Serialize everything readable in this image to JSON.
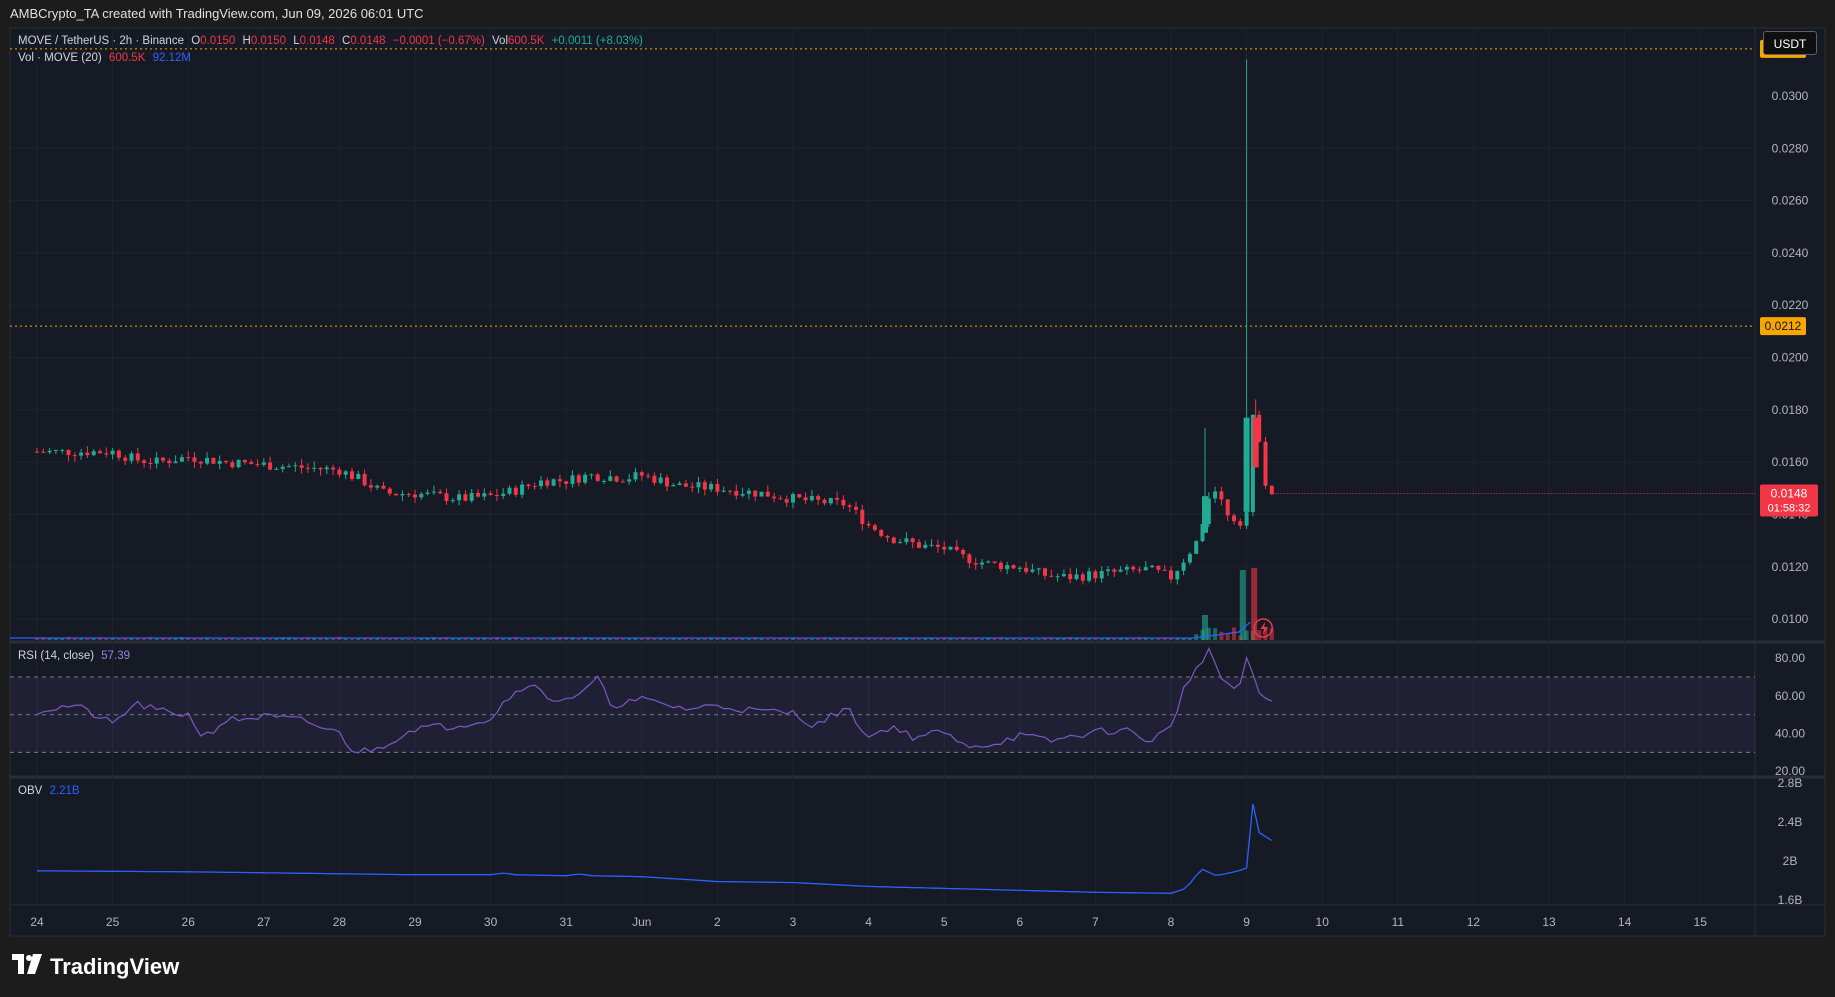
{
  "header": {
    "attribution": "AMBCrypto_TA created with TradingView.com, Jun 09, 2026 06:01 UTC"
  },
  "legend": {
    "symbol": "MOVE / TetherUS · 2h · Binance",
    "o_label": "O",
    "o_value": "0.0150",
    "h_label": "H",
    "h_value": "0.0150",
    "l_label": "L",
    "l_value": "0.0148",
    "c_label": "C",
    "c_value": "0.0148",
    "change": "−0.0001 (−0.67%)",
    "vol_label": "Vol",
    "vol_value": "600.5K",
    "vol_change": "+0.0011 (+8.03%)",
    "vol_study": "Vol · MOVE (20)",
    "vol_study_value": "600.5K",
    "vol_ma_value": "92.12M",
    "rsi_study": "RSI (14, close)",
    "rsi_value": "57.39",
    "obv_study": "OBV",
    "obv_value": "2.21B"
  },
  "currency_button": "USDT",
  "footer": {
    "brand": "TradingView"
  },
  "colors": {
    "up": "#22ab94",
    "down": "#f23645",
    "level": "#f7a600",
    "rsi_line": "#7e57c2",
    "obv_line": "#2962ff",
    "bg": "#161a25"
  },
  "chart_data": {
    "type": "candlestick",
    "price_axis": {
      "ticks": [
        0.01,
        0.012,
        0.014,
        0.016,
        0.018,
        0.02,
        0.022,
        0.024,
        0.026,
        0.028,
        0.03
      ],
      "tick_labels": [
        "0.0100",
        "0.0120",
        "0.0140",
        "0.0160",
        "0.0180",
        "0.0200",
        "0.0220",
        "0.0240",
        "0.0260",
        "0.0280",
        "0.0300"
      ],
      "range": [
        0.0092,
        0.0326
      ]
    },
    "levels": [
      {
        "value": 0.0318,
        "label": "0.0318"
      },
      {
        "value": 0.0212,
        "label": "0.0212"
      }
    ],
    "last_price": {
      "value": 0.0148,
      "label": "0.0148",
      "countdown": "01:58:32"
    },
    "x_axis": {
      "labels": [
        "24",
        "25",
        "26",
        "27",
        "28",
        "29",
        "30",
        "31",
        "Jun",
        "2",
        "3",
        "4",
        "5",
        "6",
        "7",
        "8",
        "9",
        "10",
        "11",
        "12",
        "13",
        "14",
        "15"
      ]
    },
    "price_series": {
      "anchors": [
        [
          0,
          0.0164
        ],
        [
          1,
          0.0164
        ],
        [
          1.3,
          0.0161
        ],
        [
          1.6,
          0.016
        ],
        [
          2,
          0.0162
        ],
        [
          2.5,
          0.016
        ],
        [
          3,
          0.0159
        ],
        [
          3.5,
          0.0158
        ],
        [
          4,
          0.0157
        ],
        [
          4.3,
          0.0153
        ],
        [
          4.6,
          0.0148
        ],
        [
          5,
          0.0148
        ],
        [
          5.3,
          0.0147
        ],
        [
          5.6,
          0.0146
        ],
        [
          6,
          0.0147
        ],
        [
          6.3,
          0.0149
        ],
        [
          6.7,
          0.0153
        ],
        [
          7,
          0.0153
        ],
        [
          7.3,
          0.0155
        ],
        [
          7.8,
          0.0154
        ],
        [
          8,
          0.0155
        ],
        [
          8.5,
          0.0151
        ],
        [
          9,
          0.015
        ],
        [
          9.6,
          0.0148
        ],
        [
          10,
          0.0146
        ],
        [
          10.3,
          0.0145
        ],
        [
          10.7,
          0.0144
        ],
        [
          11,
          0.0136
        ],
        [
          11.3,
          0.0131
        ],
        [
          11.7,
          0.0128
        ],
        [
          12,
          0.0127
        ],
        [
          12.2,
          0.0124
        ],
        [
          12.6,
          0.0121
        ],
        [
          13,
          0.012
        ],
        [
          13.3,
          0.0117
        ],
        [
          13.6,
          0.0116
        ],
        [
          14,
          0.0117
        ],
        [
          14.3,
          0.0118
        ],
        [
          14.7,
          0.0119
        ],
        [
          15,
          0.0116
        ],
        [
          15.2,
          0.0124
        ],
        [
          15.4,
          0.0132
        ],
        [
          15.5,
          0.0147
        ],
        [
          15.6,
          0.0151
        ],
        [
          15.7,
          0.0142
        ],
        [
          15.9,
          0.0137
        ],
        [
          16.0,
          0.0141
        ],
        [
          16.05,
          0.0176
        ],
        [
          16.15,
          0.0177
        ],
        [
          16.2,
          0.0155
        ],
        [
          16.3,
          0.015
        ],
        [
          16.33,
          0.0148
        ]
      ],
      "spikes": [
        {
          "x": 16.0,
          "high": 0.0314,
          "open": 0.0141,
          "close": 0.0177
        },
        {
          "x": 15.45,
          "high": 0.0173,
          "open": 0.0133,
          "close": 0.0147
        },
        {
          "x": 16.12,
          "high": 0.0184,
          "open": 0.0177,
          "close": 0.0158
        }
      ]
    },
    "rsi": {
      "ticks": [
        20,
        40,
        60,
        80
      ],
      "tick_labels": [
        "20.00",
        "40.00",
        "60.00",
        "80.00"
      ],
      "range": [
        18,
        87
      ],
      "band": [
        30,
        70
      ],
      "anchors": [
        [
          0,
          52
        ],
        [
          0.5,
          55
        ],
        [
          1,
          45
        ],
        [
          1.3,
          56
        ],
        [
          1.6,
          52
        ],
        [
          2,
          50
        ],
        [
          2.2,
          38
        ],
        [
          2.5,
          47
        ],
        [
          3,
          49
        ],
        [
          3.5,
          47
        ],
        [
          4,
          40
        ],
        [
          4.2,
          30
        ],
        [
          4.5,
          32
        ],
        [
          5,
          43
        ],
        [
          5.5,
          44
        ],
        [
          6,
          48
        ],
        [
          6.2,
          58
        ],
        [
          6.5,
          67
        ],
        [
          6.8,
          58
        ],
        [
          7.2,
          60
        ],
        [
          7.4,
          70
        ],
        [
          7.6,
          55
        ],
        [
          8,
          58
        ],
        [
          8.6,
          53
        ],
        [
          9,
          55
        ],
        [
          9.5,
          52
        ],
        [
          10,
          51
        ],
        [
          10.3,
          44
        ],
        [
          10.7,
          54
        ],
        [
          11,
          38
        ],
        [
          11.3,
          44
        ],
        [
          11.6,
          38
        ],
        [
          12,
          41
        ],
        [
          12.2,
          34
        ],
        [
          12.6,
          34
        ],
        [
          13,
          39
        ],
        [
          13.4,
          36
        ],
        [
          14,
          41
        ],
        [
          14.4,
          42
        ],
        [
          14.7,
          36
        ],
        [
          15,
          43
        ],
        [
          15.2,
          68
        ],
        [
          15.4,
          76
        ],
        [
          15.5,
          86
        ],
        [
          15.7,
          65
        ],
        [
          15.9,
          64
        ],
        [
          16.0,
          80
        ],
        [
          16.15,
          62
        ],
        [
          16.33,
          57
        ]
      ]
    },
    "obv": {
      "ticks": [
        1.6,
        2.0,
        2.4,
        2.8
      ],
      "tick_labels": [
        "1.6B",
        "2B",
        "2.4B",
        "2.8B"
      ],
      "range": [
        1.55,
        2.83
      ],
      "anchors": [
        [
          0,
          1.9
        ],
        [
          2,
          1.89
        ],
        [
          3,
          1.88
        ],
        [
          4,
          1.87
        ],
        [
          5,
          1.86
        ],
        [
          6,
          1.86
        ],
        [
          6.2,
          1.88
        ],
        [
          6.3,
          1.86
        ],
        [
          7,
          1.85
        ],
        [
          7.2,
          1.87
        ],
        [
          7.3,
          1.85
        ],
        [
          8,
          1.84
        ],
        [
          9,
          1.79
        ],
        [
          10,
          1.78
        ],
        [
          11,
          1.74
        ],
        [
          12,
          1.72
        ],
        [
          13,
          1.7
        ],
        [
          14,
          1.68
        ],
        [
          15,
          1.67
        ],
        [
          15.2,
          1.72
        ],
        [
          15.4,
          1.92
        ],
        [
          15.6,
          1.85
        ],
        [
          15.9,
          1.9
        ],
        [
          16.0,
          1.93
        ],
        [
          16.05,
          2.73
        ],
        [
          16.15,
          2.3
        ],
        [
          16.33,
          2.21
        ]
      ]
    },
    "volume_notes": "Volume bars are minimal until Jun 8-9, with large spikes near the final candles."
  }
}
